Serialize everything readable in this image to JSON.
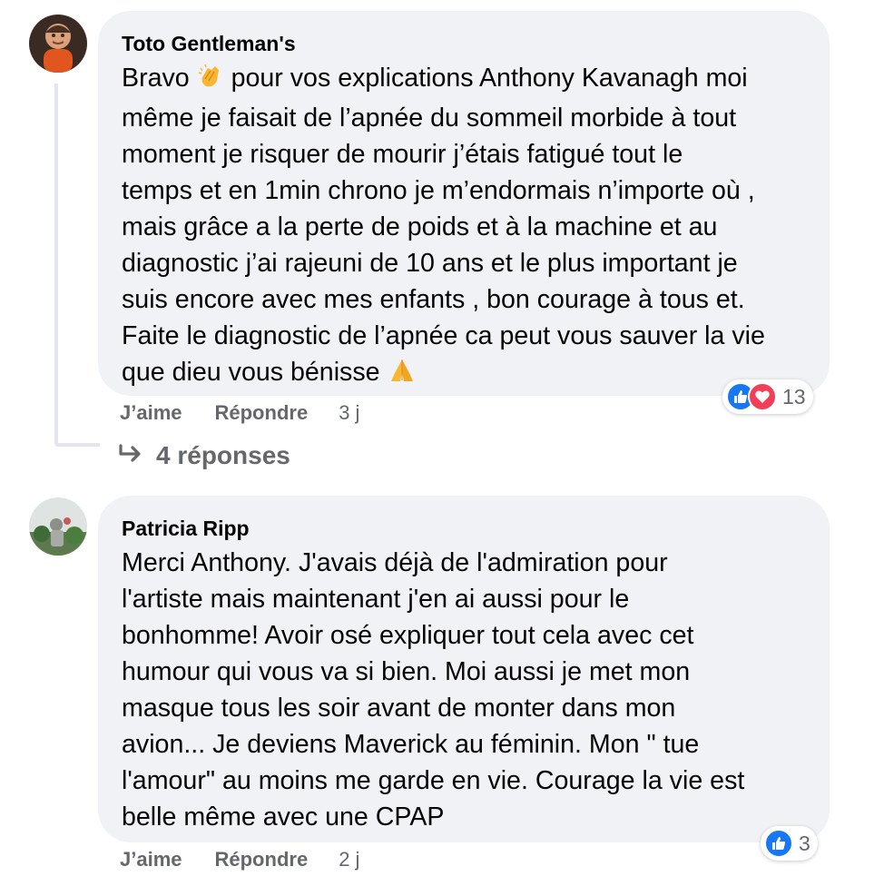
{
  "comments": [
    {
      "author": "Toto Gentleman's",
      "text_before": "Bravo ",
      "emoji1": "clapping-hands",
      "text_middle": " pour vos explications Anthony Kavanagh moi\nmême je faisait de l’apnée du sommeil morbide à tout\nmoment je risquer de mourir j’étais fatigué tout le\ntemps et en 1min chrono je m’endormais n’importe où ,\nmais grâce a la perte de poids et à la machine et au\ndiagnostic j’ai rajeuni de 10 ans et le plus important je\nsuis encore avec mes enfants , bon courage à tous et.\nFaite le diagnostic de l’apnée ca peut vous sauver la vie\nque dieu vous bénisse ",
      "emoji2": "folded-hands",
      "like": "J’aime",
      "reply": "Répondre",
      "time": "3 j",
      "reaction_count": "13",
      "replies_label": "4 réponses"
    },
    {
      "author": "Patricia Ripp",
      "text": "Merci Anthony. J'avais déjà de l'admiration pour\nl'artiste mais maintenant j'en ai aussi pour le\nbonhomme! Avoir osé expliquer tout cela avec cet\nhumour qui vous va si bien. Moi aussi je met mon\nmasque tous les soir avant de monter dans mon\navion... Je deviens Maverick au féminin. Mon \" tue\nl'amour\" au moins me garde en vie. Courage la vie est\nbelle même avec une CPAP",
      "like": "J’aime",
      "reply": "Répondre",
      "time": "2 j",
      "reaction_count": "3"
    }
  ],
  "colors": {
    "bubble": "#f0f2f5",
    "like_blue": "#1877f2",
    "love_red": "#f33e58",
    "meta_gray": "#65676b"
  },
  "icons": [
    "like-icon",
    "love-icon",
    "reply-arrow-icon",
    "clapping-hands-emoji",
    "folded-hands-emoji"
  ]
}
